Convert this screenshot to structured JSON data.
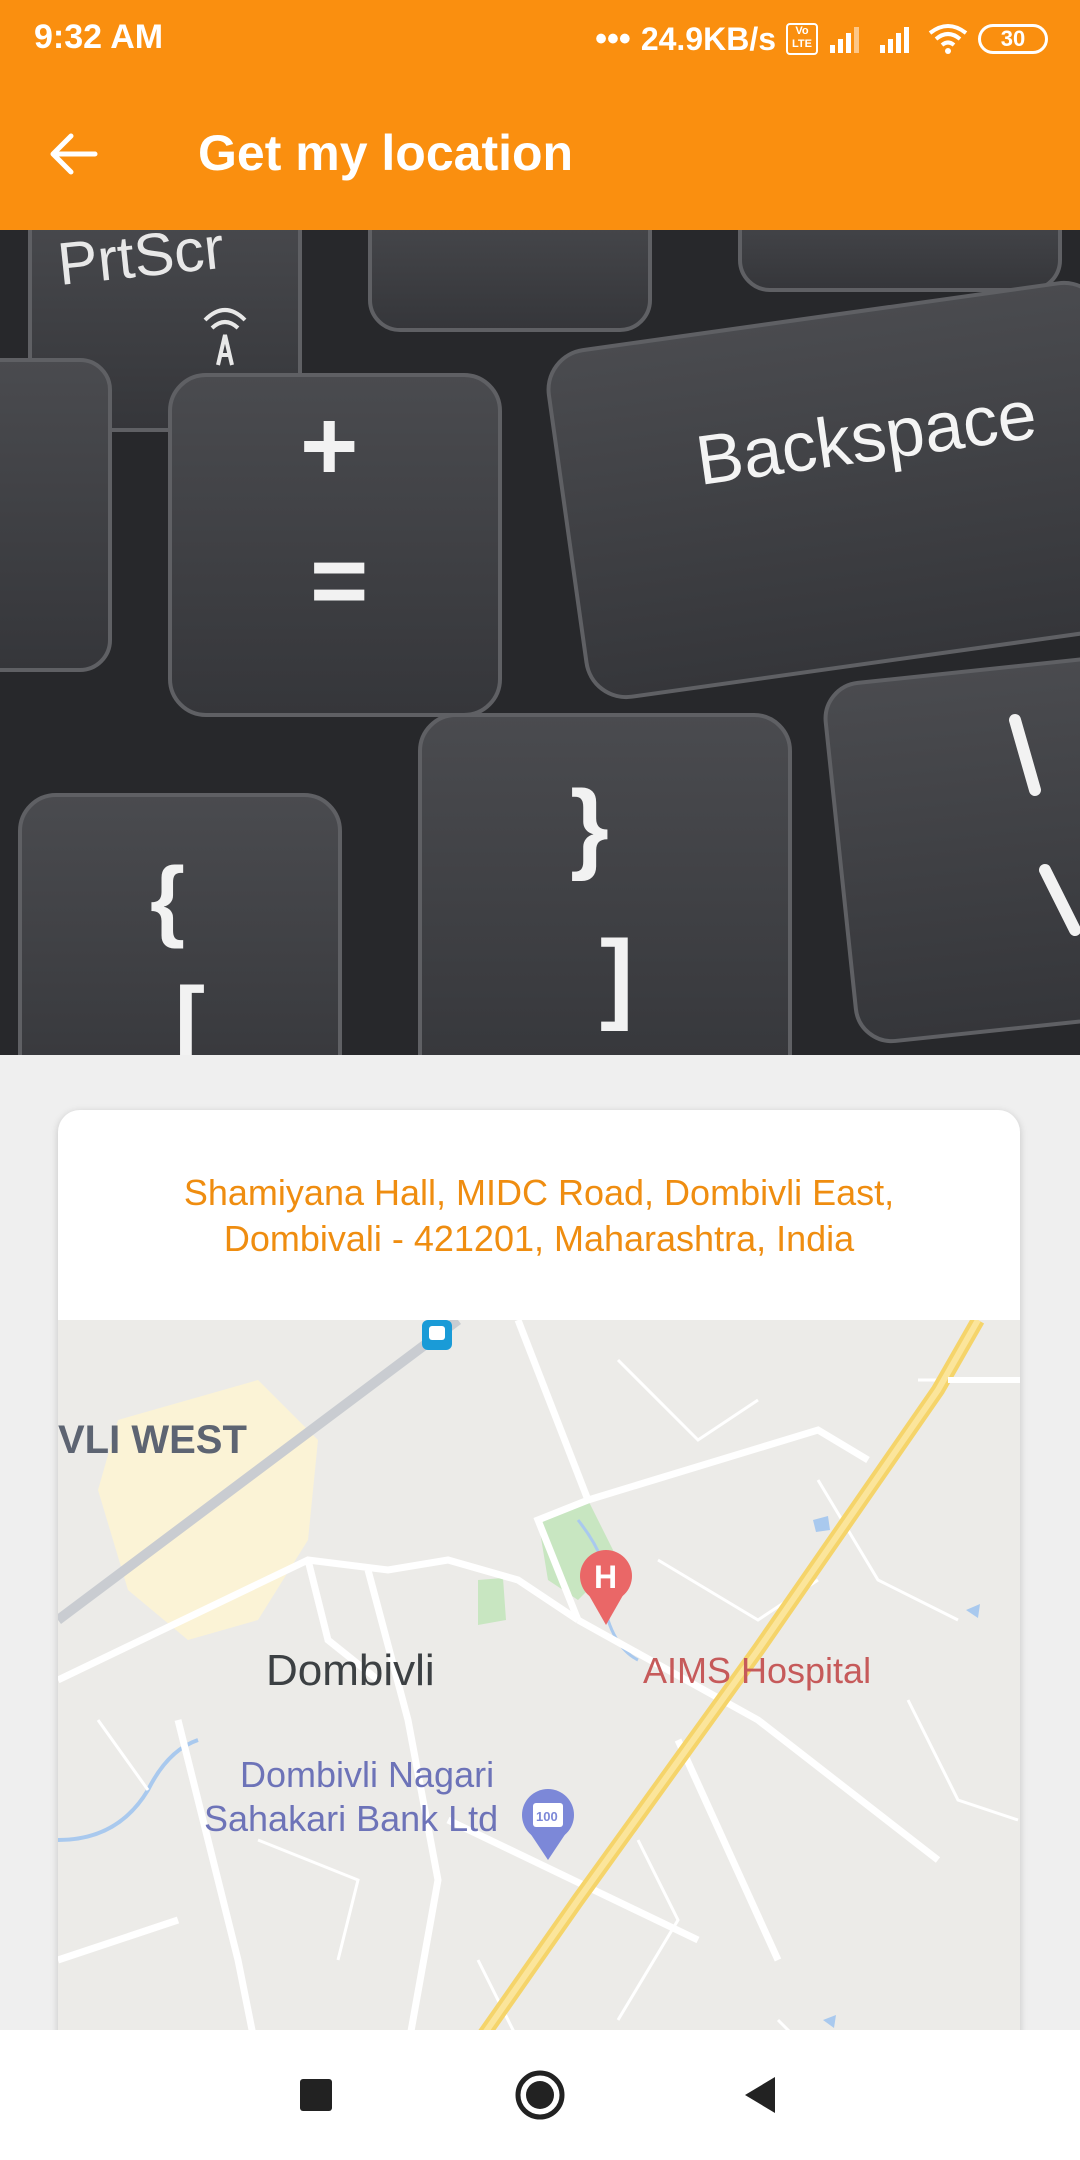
{
  "status_bar": {
    "time": "9:32 AM",
    "network_speed": "24.9KB/s",
    "battery": "30",
    "volte": "Vo LTE"
  },
  "app_bar": {
    "title": "Get my location"
  },
  "location": {
    "address_line1": "Shamiyana Hall, MIDC Road, Dombivli East,",
    "address_line2": "Dombivali - 421201, Maharashtra, India"
  },
  "map": {
    "labels": {
      "area_west": "VLI WEST",
      "city": "Dombivli",
      "hospital": "AIMS Hospital",
      "bank_line1": "Dombivli Nagari",
      "bank_line2": "Sahakari Bank Ltd",
      "hospital_marker": "H",
      "bank_marker": "100"
    }
  },
  "photo": {
    "key_prtsc": "PrtScr",
    "key_backspace": "Backspace",
    "key_plus": "+",
    "key_equals": "=",
    "key_brace_close": "}",
    "key_bracket_close": "]",
    "key_brace_open": "{",
    "key_bracket_open": "["
  },
  "colors": {
    "accent": "#fa8f0f",
    "address_text": "#ef8d10"
  }
}
